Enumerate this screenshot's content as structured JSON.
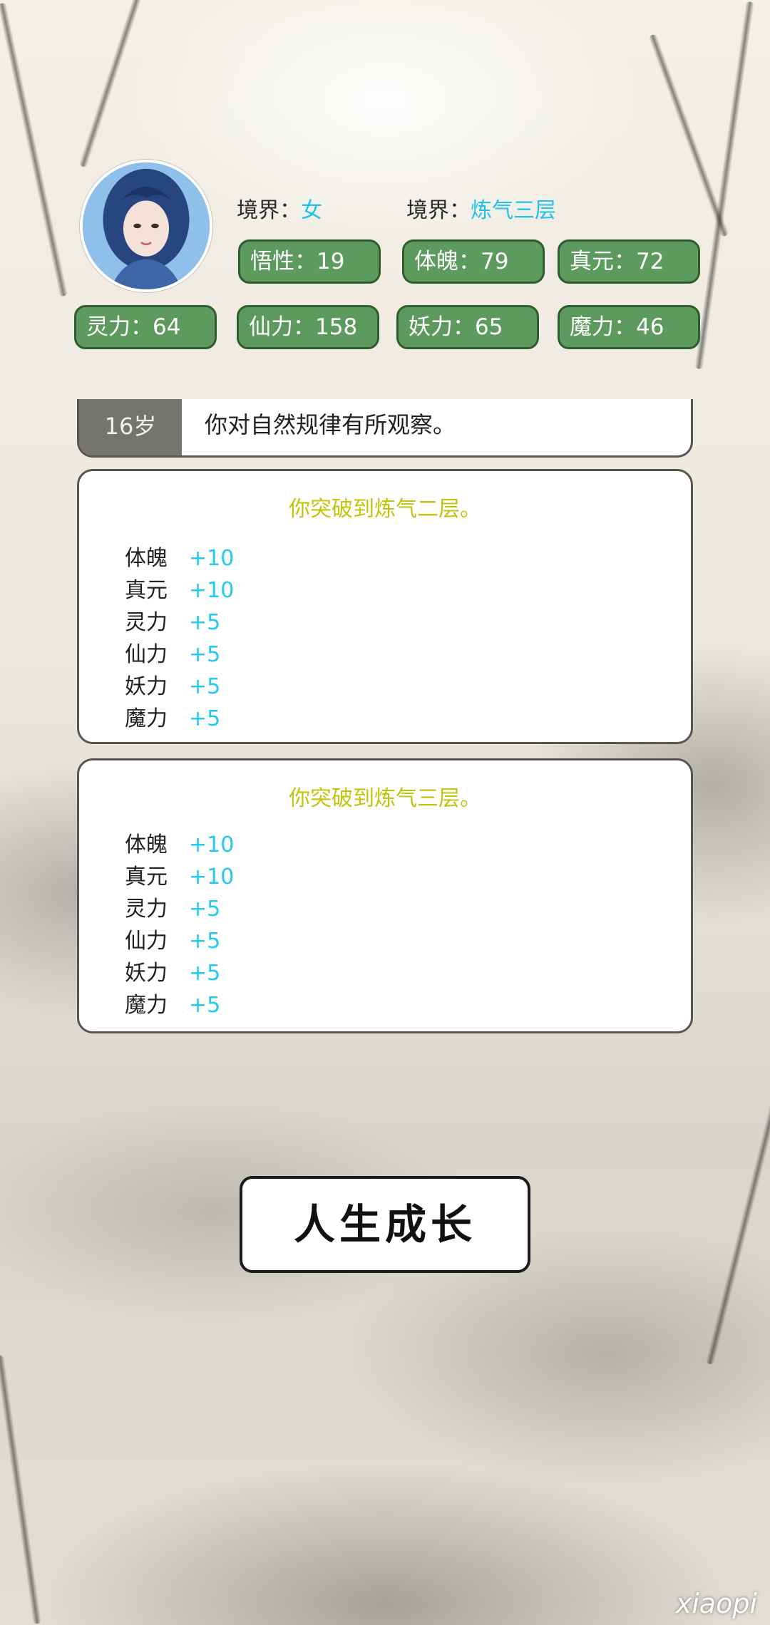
{
  "profile": {
    "gender_label": "境界：",
    "gender_value": "女",
    "realm_label": "境界：",
    "realm_value": "炼气三层"
  },
  "stats": [
    {
      "label": "悟性：19"
    },
    {
      "label": "体魄：79"
    },
    {
      "label": "真元：72"
    },
    {
      "label": "灵力：64"
    },
    {
      "label": "仙力：158"
    },
    {
      "label": "妖力：65"
    },
    {
      "label": "魔力：46"
    }
  ],
  "log": {
    "first": {
      "age": "16岁",
      "text": "你对自然规律有所观察。"
    },
    "cards": [
      {
        "title": "你突破到炼气二层。",
        "gains": [
          {
            "attr": "体魄",
            "value": "+10"
          },
          {
            "attr": "真元",
            "value": "+10"
          },
          {
            "attr": "灵力",
            "value": "+5"
          },
          {
            "attr": "仙力",
            "value": "+5"
          },
          {
            "attr": "妖力",
            "value": "+5"
          },
          {
            "attr": "魔力",
            "value": "+5"
          }
        ]
      },
      {
        "title": "你突破到炼气三层。",
        "gains": [
          {
            "attr": "体魄",
            "value": "+10"
          },
          {
            "attr": "真元",
            "value": "+10"
          },
          {
            "attr": "灵力",
            "value": "+5"
          },
          {
            "attr": "仙力",
            "value": "+5"
          },
          {
            "attr": "妖力",
            "value": "+5"
          },
          {
            "attr": "魔力",
            "value": "+5"
          }
        ]
      }
    ]
  },
  "action": {
    "grow_label": "人生成长"
  },
  "watermark": "xiaopi"
}
